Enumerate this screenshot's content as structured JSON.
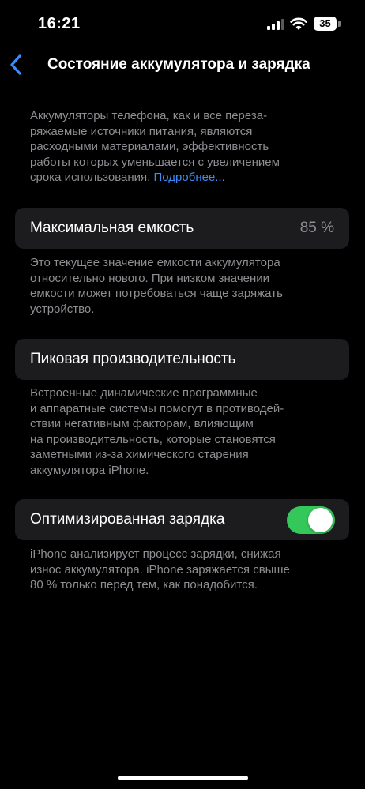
{
  "status_bar": {
    "time": "16:21",
    "battery_level": "35"
  },
  "nav": {
    "title": "Состояние аккумулятора и зарядка"
  },
  "intro": {
    "lines": [
      "Аккумуляторы телефона, как и все переза-",
      "ряжаемые источники питания, являются",
      "расходными материалами, эффективность",
      "работы которых уменьшается с увеличением"
    ],
    "last_line": "срока использования.",
    "link": "Подробнее..."
  },
  "max_capacity": {
    "label": "Максимальная емкость",
    "value": "85 %",
    "description": [
      "Это текущее значение емкости аккумулятора",
      "относительно нового. При низком значении",
      "емкости может потребоваться чаще заряжать",
      "устройство."
    ]
  },
  "peak_performance": {
    "label": "Пиковая производительность",
    "description": [
      "Встроенные динамические программные",
      "и аппаратные системы помогут в противодей-",
      "ствии негативным факторам, влияющим",
      "на производительность, которые становятся",
      "заметными из-за химического старения",
      "аккумулятора iPhone."
    ]
  },
  "optimized_charging": {
    "label": "Оптимизированная зарядка",
    "enabled": true,
    "description": [
      "iPhone анализирует процесс зарядки, снижая",
      "износ аккумулятора. iPhone заряжается свыше",
      "80 % только перед тем, как понадобится."
    ]
  },
  "colors": {
    "background": "#000000",
    "card": "#1c1c1e",
    "secondary_text": "#8e8e93",
    "link": "#3e8bf7",
    "toggle_on": "#34c759"
  },
  "icons": {
    "back": "chevron-left-icon",
    "signal": "cellular-signal-icon",
    "wifi": "wifi-icon",
    "battery": "battery-icon"
  }
}
